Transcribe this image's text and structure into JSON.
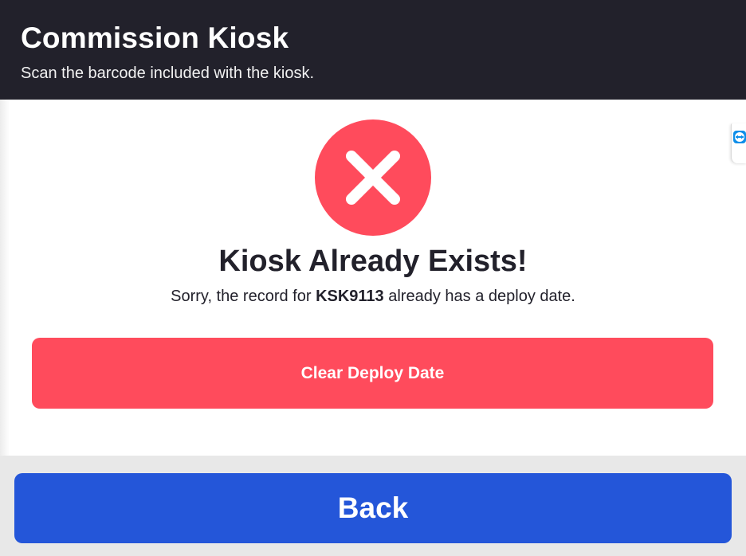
{
  "header": {
    "title": "Commission Kiosk",
    "subtitle": "Scan the barcode included with the kiosk."
  },
  "error": {
    "icon": "close-x-icon",
    "title": "Kiosk Already Exists!",
    "message_prefix": "Sorry, the record for ",
    "kiosk_id": "KSK9113",
    "message_suffix": " already has a deploy date."
  },
  "actions": {
    "clear_deploy_date_label": "Clear Deploy Date",
    "back_label": "Back"
  },
  "side_widget": {
    "icon": "remote-support-icon"
  },
  "colors": {
    "header_bg": "#22212b",
    "error_red": "#ff4b5c",
    "primary_blue": "#2456d9",
    "footer_bg": "#e8e8e8"
  }
}
